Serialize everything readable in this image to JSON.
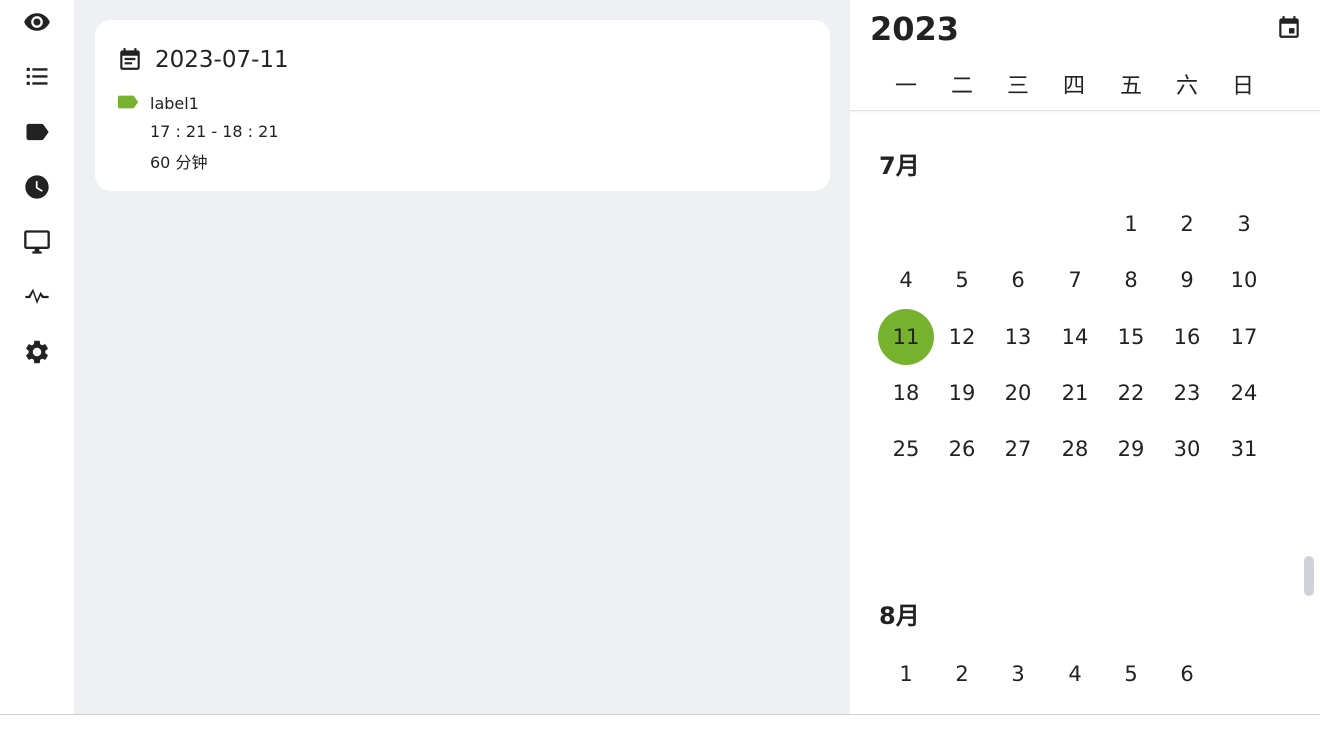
{
  "sidebar": {
    "items": [
      {
        "name": "eye-icon"
      },
      {
        "name": "list-icon"
      },
      {
        "name": "tag-icon"
      },
      {
        "name": "clock-icon"
      },
      {
        "name": "monitor-icon"
      },
      {
        "name": "activity-icon"
      },
      {
        "name": "settings-icon"
      }
    ]
  },
  "card": {
    "date": "2023-07-11",
    "label": "label1",
    "label_color": "#77b22f",
    "time_range": "17 : 21 - 18 : 21",
    "duration": "60 分钟"
  },
  "calendar": {
    "year": "2023",
    "weekdays": [
      "一",
      "二",
      "三",
      "四",
      "五",
      "六",
      "日"
    ],
    "accent_color": "#77b22f",
    "months": [
      {
        "title": "7月",
        "first_weekday": 5,
        "days": 31,
        "selected_day": 11
      },
      {
        "title": "8月",
        "first_weekday": 1,
        "days_visible": 6
      }
    ]
  }
}
